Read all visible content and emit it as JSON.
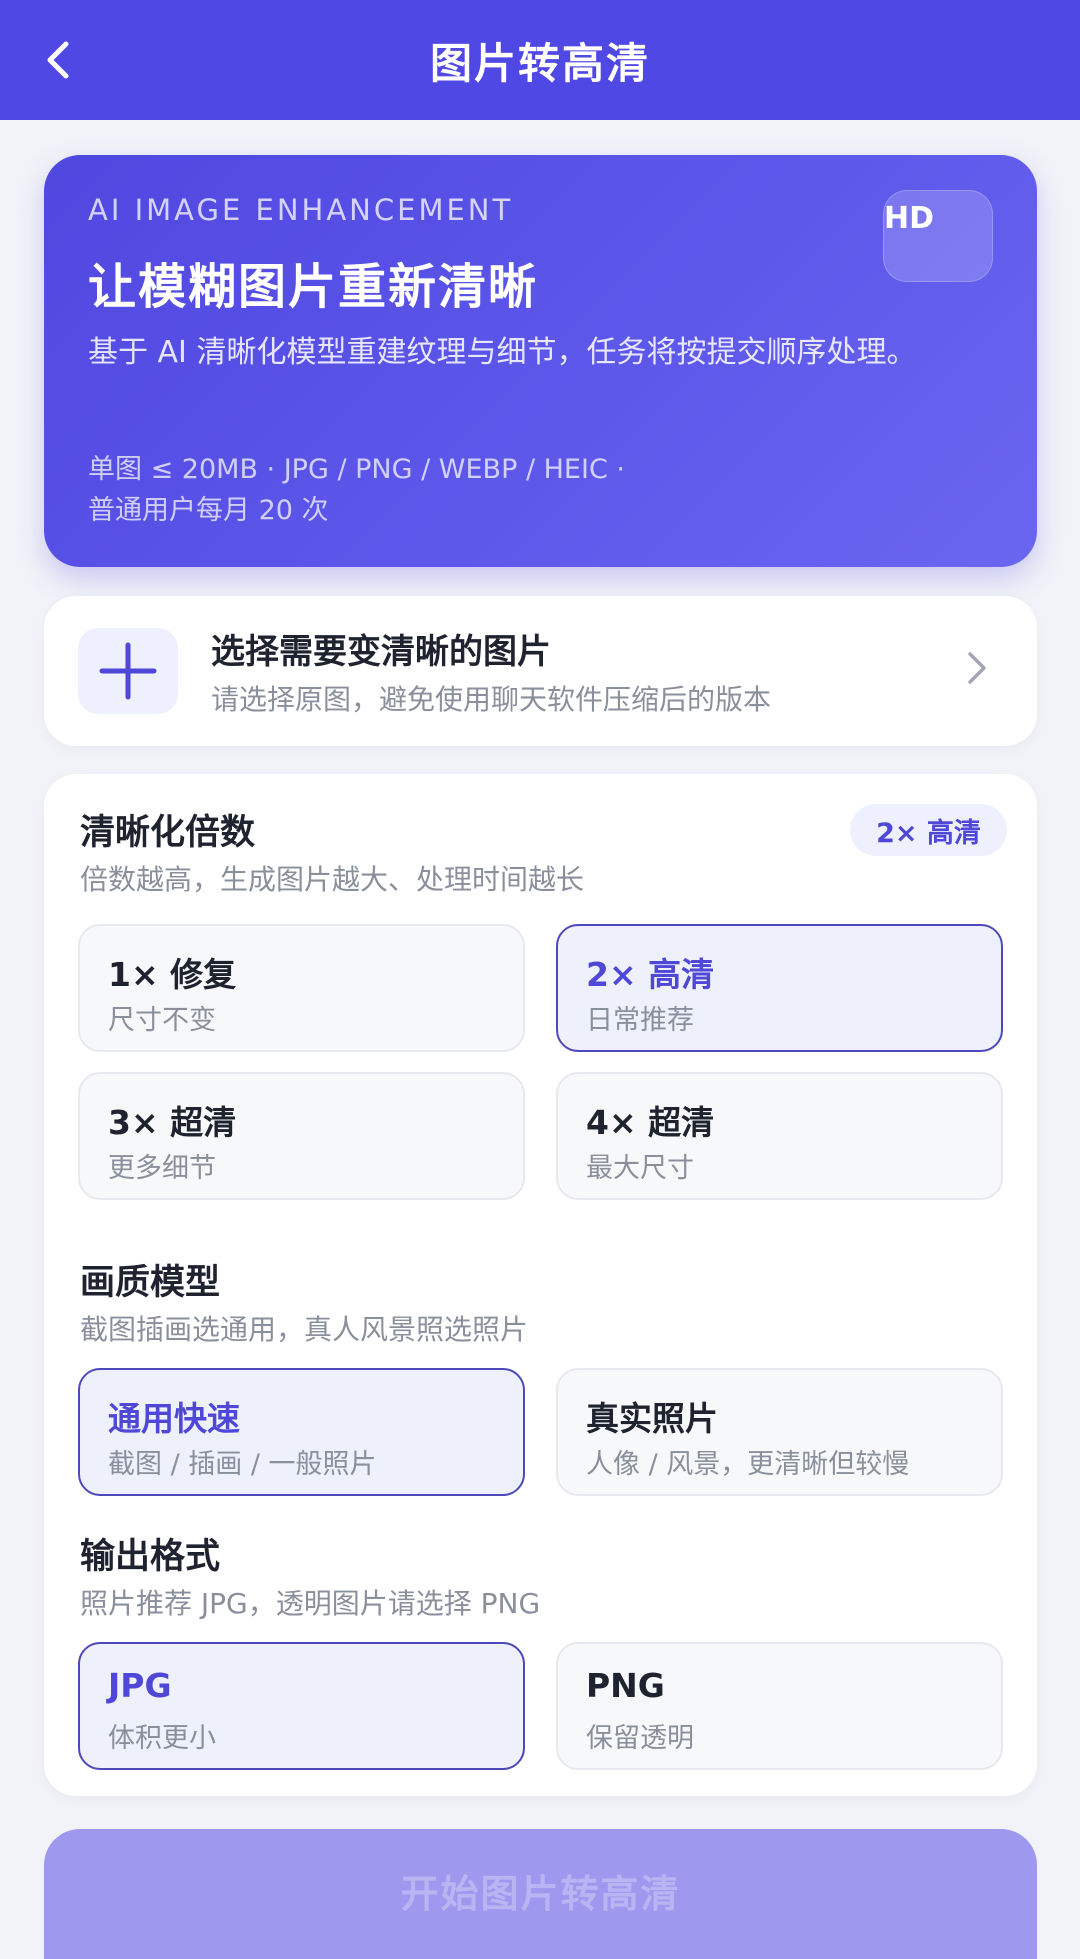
{
  "header": {
    "title": "图片转高清",
    "back_icon": "chevron-left-icon"
  },
  "hero": {
    "kicker": "AI IMAGE ENHANCEMENT",
    "title": "让模糊图片重新清晰",
    "description": "基于 AI 清晰化模型重建纹理与细节，任务将按提交顺序处理。",
    "meta_line1": "单图 ≤ 20MB · JPG / PNG / WEBP / HEIC ·",
    "meta_line2": "普通用户每月 20 次",
    "badge": "HD"
  },
  "upload": {
    "title": "选择需要变清晰的图片",
    "subtitle": "请选择原图，避免使用聊天软件压缩后的版本"
  },
  "scale": {
    "title": "清晰化倍数",
    "subtitle": "倍数越高，生成图片越大、处理时间越长",
    "current": "2× 高清",
    "options": [
      {
        "label": "1× 修复",
        "sub": "尺寸不变",
        "selected": false
      },
      {
        "label": "2× 高清",
        "sub": "日常推荐",
        "selected": true
      },
      {
        "label": "3× 超清",
        "sub": "更多细节",
        "selected": false
      },
      {
        "label": "4× 超清",
        "sub": "最大尺寸",
        "selected": false
      }
    ]
  },
  "model": {
    "title": "画质模型",
    "subtitle": "截图插画选通用，真人风景照选照片",
    "options": [
      {
        "label": "通用快速",
        "sub": "截图 / 插画 / 一般照片",
        "selected": true
      },
      {
        "label": "真实照片",
        "sub": "人像 / 风景，更清晰但较慢",
        "selected": false
      }
    ]
  },
  "format": {
    "title": "输出格式",
    "subtitle": "照片推荐 JPG，透明图片请选择 PNG",
    "options": [
      {
        "label": "JPG",
        "sub": "体积更小",
        "selected": true
      },
      {
        "label": "PNG",
        "sub": "保留透明",
        "selected": false
      }
    ]
  },
  "cta": {
    "label": "开始图片转高清"
  },
  "colors": {
    "primary": "#5048e5",
    "selected_border": "#4f48b8",
    "cta_disabled": "#9e99ef"
  }
}
